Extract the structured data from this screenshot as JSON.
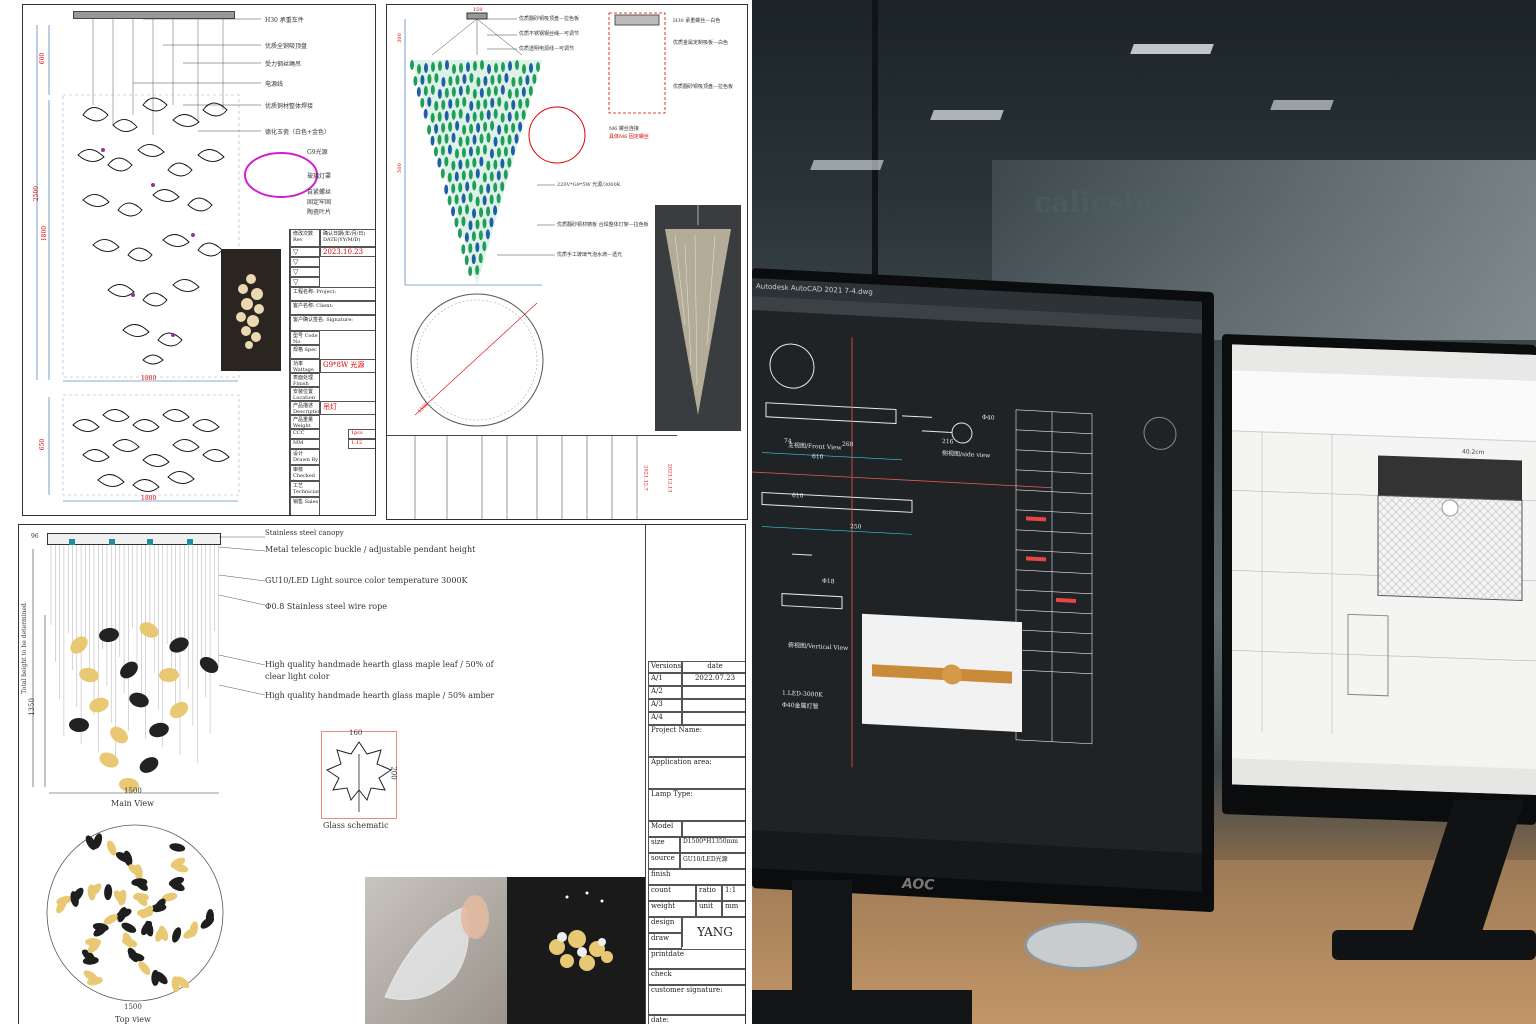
{
  "sheet1": {
    "callouts": [
      "H30 承重车件",
      "优质全铜吸顶盘",
      "受力钢丝绳吊",
      "电源线",
      "优质铜材整体焊接",
      "德化玉瓷（白色+金色）",
      "G9光源",
      "玻璃灯罩",
      "自紧螺丝",
      "固定牢固",
      "陶瓷叶片"
    ],
    "dims": [
      "600",
      "2500",
      "1800",
      "1800",
      "1800",
      "650"
    ],
    "table": [
      [
        "修改次数 Rev",
        "确认日期(年/月/日) DATE(YY/M/D)"
      ],
      [
        "",
        "2023.10.23"
      ],
      [
        "工程名称: Project:",
        ""
      ],
      [
        "客户名称: Client:",
        ""
      ],
      [
        "客户确认签名: Signature:",
        ""
      ],
      [
        "型号 Code No",
        ""
      ],
      [
        "规格 Spec",
        ""
      ],
      [
        "功率 Wattage",
        "G9*8W 光源"
      ],
      [
        "表面处理 Finish",
        ""
      ],
      [
        "安装位置 Location",
        ""
      ],
      [
        "产品描述 Description",
        "吊灯"
      ],
      [
        "产品重量 Weight",
        ""
      ],
      [
        "比例 Scale",
        "1:12"
      ],
      [
        "设计 Drawn By",
        ""
      ],
      [
        "审核 Checked by",
        ""
      ],
      [
        "工艺 Technician",
        ""
      ],
      [
        "销售 Sales",
        ""
      ]
    ],
    "qty": "1pcs",
    "unit": "MM",
    "ratio_label": "CCC"
  },
  "sheet2": {
    "callouts": [
      "优质翻砂铜吸顶盘—拉色板",
      "优质不锈钢钢丝绳—可调节",
      "优质透明电源线—可调节",
      "220V*G9*5W 光源/3000K",
      "优质翻砂铜材铸板 合焊整体灯架—拉色板",
      "优质手工玻璃气泡水滴—透光",
      "H30 承重螺丝—白色",
      "优质金属定制吸板—白色",
      "优质翻砂铜吸顶盘—拉色板",
      "M6 螺丝连接",
      "具体M6 固定螺丝"
    ],
    "dims": [
      "150",
      "300",
      "500",
      "500",
      "1500"
    ],
    "date": "2021.12.7",
    "date2": "2023.12.13"
  },
  "sheet3": {
    "canopy": "Stainless steel canopy",
    "buckle": "Metal telescopic buckle / adjustable pendant height",
    "light": "GU10/LED Light source color temperature 3000K",
    "wire": "Φ0.8 Stainless steel wire rope",
    "leaf1a": "High quality handmade hearth glass maple leaf / 50% of",
    "leaf1b": "clear light color",
    "leaf2": "High quality handmade hearth glass maple / 50% amber",
    "total_height": "Total height to be determined",
    "dim_top": "96",
    "dim_1350": "1350",
    "dim_1500": "1500",
    "dim_1500b": "1500",
    "main_view": "Main View",
    "top_view": "Top view",
    "glass_schematic": "Glass schematic",
    "gw": "160",
    "gh": "200",
    "table": {
      "version_label": "Versions",
      "date_label": "date",
      "versions": [
        "A/1",
        "A/2",
        "A/3",
        "A/4"
      ],
      "date_value": "2022.07.23",
      "project": "Project Name:",
      "area": "Application area:",
      "lamp": "Lamp Type:",
      "model": "Model",
      "size_label": "size",
      "size_value": "D1500*H1350mm",
      "source_label": "source",
      "source_value": "GU10/LED光源",
      "finish": "finish",
      "count": "count",
      "ratio_label": "ratio",
      "ratio_value": "1:1",
      "weight": "weight",
      "unit_label": "unit",
      "unit_value": "mm",
      "design": "design",
      "design_value": "YANG",
      "draw": "draw",
      "printdate": "printdate",
      "check": "check",
      "customer": "customer signature:",
      "date2": "date:"
    }
  },
  "photo": {
    "watermark": "calicslight",
    "cad_title": "Autodesk AutoCAD 2021  7-4.dwg",
    "cad_front": "主视图/Front View",
    "cad_vertical": "俯视图/Vertical View",
    "cad_side": "侧视图/side view",
    "cad_dims": [
      "74",
      "268",
      "610",
      "216",
      "610",
      "250",
      "Φ18",
      "Φ40"
    ],
    "cad_note1": "1.LED-3000K",
    "cad_note2": "Φ40金属灯管",
    "monitor_brand": "AOC",
    "right_dims": [
      "40.2cm"
    ]
  },
  "colors": {
    "leaf_gold": "#e8c872",
    "glass_green": "#1e9e5a",
    "glass_blue": "#1f5fa8",
    "cad_bg": "#1f2326",
    "desk": "#b48a5e"
  }
}
